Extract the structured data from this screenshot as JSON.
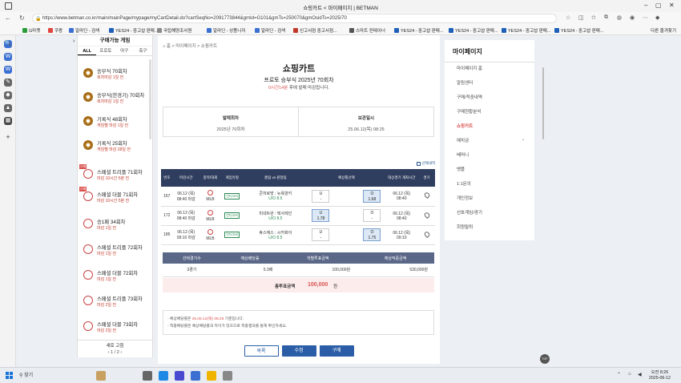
{
  "browser": {
    "tab_title": "쇼핑카트 < 마이페이지 | BETMAN",
    "url": "https://www.betman.co.kr/main/mainPage/mypage/myCartDetail.do?cartSeqNo=2091773844&gmId=G101&gmTs=250070&gmOsidTs=2025/70",
    "bookmarks": [
      "G마켓",
      "쿠팡",
      "알라딘 - 검색",
      "YES24 - 중고샵 판매...",
      "국립해양조사원",
      "알라딘 - 상품니저",
      "알라딘 - 검색",
      "신고서점 중고서점...",
      "스마트 컨테이너",
      "YES24 - 중고샵 판매...",
      "YES24 - 중고샵 판매...",
      "YES24 - 중고샵 판매...",
      "YES24 - 중고샵 판매..."
    ],
    "bookmark_folder": "다른 즐겨찾기"
  },
  "games_panel": {
    "title": "구매가능 게임",
    "tabs": [
      "ALL",
      "프로토",
      "야구",
      "축구"
    ],
    "items": [
      {
        "name": "승부식 70회차",
        "sub": "회차마감 1일 전",
        "tag": ""
      },
      {
        "name": "승부식(한경기) 70회차",
        "sub": "회차마감 1일 전",
        "tag": ""
      },
      {
        "name": "기록식 48회차",
        "sub": "게임별 마감 1일 전",
        "tag": ""
      },
      {
        "name": "기록식 25회차",
        "sub": "게임별 마감 28일 전",
        "tag": ""
      },
      {
        "name": "스페셜 트리플 71회차",
        "sub": "마감 10시간 5분 전",
        "tag": "스페"
      },
      {
        "name": "스페셜 더블 71회차",
        "sub": "마감 10시간 5분 전",
        "tag": "스페"
      },
      {
        "name": "승1패 34회차",
        "sub": "마감 1일 전",
        "tag": ""
      },
      {
        "name": "스페셜 트리플 72회차",
        "sub": "마감 1일 전",
        "tag": ""
      },
      {
        "name": "스페셜 더블 72회차",
        "sub": "마감 1일 전",
        "tag": ""
      },
      {
        "name": "스페셜 트리플 73회차",
        "sub": "마감 2일 전",
        "tag": ""
      },
      {
        "name": "스페셜 더블 73회차",
        "sub": "마감 2일 전",
        "tag": ""
      }
    ],
    "refresh": "새로 고침",
    "pager": "1 / 2"
  },
  "cart": {
    "breadcrumb": [
      "홈",
      "마이페이지",
      "쇼핑카트"
    ],
    "title": "쇼핑카트",
    "subtitle": "프로토 승부식 2025년 70회차",
    "deadline_red": "0시간14분",
    "deadline_rest": " 후에 발매 마감됩니다.",
    "info": {
      "sale_label": "발매회차",
      "sale_value": "2025년 70회차",
      "stored_label": "보관일시",
      "stored_value": "25.06.12(목) 08:25"
    },
    "check_label": "선택내역",
    "table_headers": [
      "번호",
      "마감시간",
      "종목/대회",
      "게임유형",
      "홈팀 vs 원정팀",
      "예상틀선택",
      "",
      "",
      "대상경기 개최시간",
      "경기"
    ],
    "rows": [
      {
        "no": "167",
        "date": "06.12 (목)",
        "time": "08:40 마감",
        "league": "MLB",
        "type": "언더오버",
        "match": "콘저로망 : 뉴욕양키",
        "uo": "U/O 8.5",
        "u_label": "U",
        "u_val": "-",
        "o_label": "O",
        "o_val": "1.68",
        "sel": "o",
        "ev_date": "06.12 (목)",
        "ev_time": "08:40"
      },
      {
        "no": "172",
        "date": "06.12 (목)",
        "time": "08:40 마감",
        "league": "MLB",
        "type": "언더오버",
        "match": "미네트완 : 텍사레인",
        "uo": "U/O 8.5",
        "u_label": "U",
        "u_val": "1.78",
        "o_label": "O",
        "o_val": "-",
        "sel": "u",
        "ev_date": "06.12 (목)",
        "ev_time": "08:40"
      },
      {
        "no": "185",
        "date": "06.12 (목)",
        "time": "09:10 마감",
        "league": "MLB",
        "type": "언더오버",
        "match": "휴스에스 : 시카화이",
        "uo": "U/O 8.5",
        "u_label": "U",
        "u_val": "-",
        "o_label": "O",
        "o_val": "1.75",
        "sel": "o",
        "ev_date": "06.12 (목)",
        "ev_time": "09:10"
      }
    ],
    "summary_headers": [
      "선택경기수",
      "예상배당률",
      "개별투표금액",
      "예상적중금액"
    ],
    "summary_values": [
      "3경기",
      "5.3배",
      "100,000원",
      "530,000원"
    ],
    "total_label": "총투표금액",
    "total_value": "100,000",
    "total_unit": "원",
    "notes": {
      "n1_pre": "- 예상배당률은 ",
      "n1_red": "25.06.12(목) 08:25",
      "n1_post": " 기준입니다.",
      "n2": "- 적중배당률은 예상배당률과 차이가 있으므로 적중결과를 통해 확인하세요."
    },
    "buttons": {
      "list": "목록",
      "edit": "수정",
      "buy": "구매"
    }
  },
  "mypage_menu": {
    "title": "마이페이지",
    "items": [
      "마이페이지 홈",
      "알림센터",
      "구매/적중내역",
      "구매현황분석",
      "쇼핑카트",
      "예치금",
      "베머니",
      "뱃플",
      "1:1문의",
      "개인정보",
      "선호게임/경기",
      "회원탈퇴"
    ],
    "active": "쇼핑카트"
  },
  "floating": "TOP",
  "taskbar": {
    "search": "찾기",
    "time": "오전 8:26",
    "date": "2025-06-12"
  }
}
